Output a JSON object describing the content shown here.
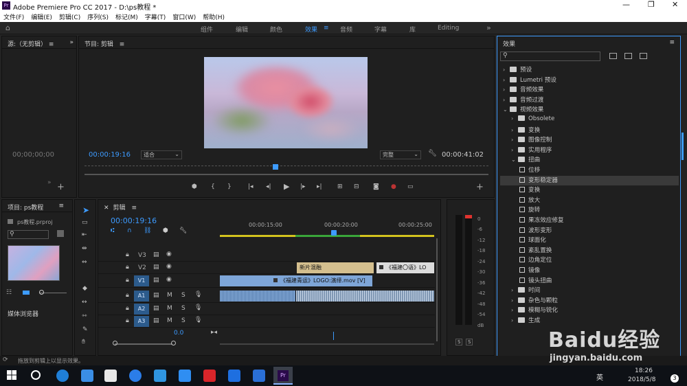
{
  "window": {
    "title": "Adobe Premiere Pro CC 2017 - D:\\ps教程 *"
  },
  "menu": [
    "文件(F)",
    "编辑(E)",
    "剪辑(C)",
    "序列(S)",
    "标记(M)",
    "字幕(T)",
    "窗口(W)",
    "帮助(H)"
  ],
  "workspaces": [
    "组件",
    "编辑",
    "颜色",
    "效果",
    "音频",
    "字幕",
    "库",
    "Editing"
  ],
  "source": {
    "title": "源:（无剪辑）",
    "timecode": "00;00;00;00"
  },
  "program": {
    "title": "节目: 剪辑",
    "timecode": "00:00:19:16",
    "fit": "适合",
    "quality": "完整",
    "duration": "00:00:41:02"
  },
  "project": {
    "title": "项目: ps教程",
    "file": "ps教程.prproj",
    "browser": "媒体浏览器"
  },
  "timeline": {
    "title": "剪辑",
    "timecode": "00:00:19:16",
    "ruler": [
      "00:00:15:00",
      "00:00:20:00",
      "00:00:25:00"
    ],
    "tracks": {
      "v3": "V3",
      "v2": "V2",
      "v1": "V1",
      "a1": "A1",
      "a2": "A2",
      "a3": "A3"
    },
    "master": "0.0",
    "clips": {
      "v2a": "新片混融",
      "v2b": "《福建〇语》LO",
      "v1": "《福建青运》LOGO:演绎.mov [V]"
    }
  },
  "meter": [
    "0",
    "-6",
    "-12",
    "-18",
    "-24",
    "-30",
    "-36",
    "-42",
    "-48",
    "-54",
    "dB"
  ],
  "effects": {
    "title": "效果",
    "items": [
      {
        "label": "预设",
        "level": 0,
        "type": "folder",
        "open": false
      },
      {
        "label": "Lumetri 预设",
        "level": 0,
        "type": "folder",
        "open": false
      },
      {
        "label": "音频效果",
        "level": 0,
        "type": "folder",
        "open": false
      },
      {
        "label": "音频过渡",
        "level": 0,
        "type": "folder",
        "open": false
      },
      {
        "label": "视频效果",
        "level": 0,
        "type": "folder",
        "open": true
      },
      {
        "label": "Obsolete",
        "level": 1,
        "type": "folder",
        "open": false
      },
      {
        "label": "变换",
        "level": 1,
        "type": "folder",
        "open": false
      },
      {
        "label": "图像控制",
        "level": 1,
        "type": "folder",
        "open": false
      },
      {
        "label": "实用程序",
        "level": 1,
        "type": "folder",
        "open": false
      },
      {
        "label": "扭曲",
        "level": 1,
        "type": "folder",
        "open": true
      },
      {
        "label": "位移",
        "level": 2,
        "type": "fx"
      },
      {
        "label": "变形稳定器",
        "level": 2,
        "type": "fx",
        "selected": true
      },
      {
        "label": "变换",
        "level": 2,
        "type": "fx"
      },
      {
        "label": "放大",
        "level": 2,
        "type": "fx"
      },
      {
        "label": "旋转",
        "level": 2,
        "type": "fx"
      },
      {
        "label": "果冻效应修复",
        "level": 2,
        "type": "fx"
      },
      {
        "label": "波形变形",
        "level": 2,
        "type": "fx"
      },
      {
        "label": "球面化",
        "level": 2,
        "type": "fx"
      },
      {
        "label": "紊乱置换",
        "level": 2,
        "type": "fx"
      },
      {
        "label": "边角定位",
        "level": 2,
        "type": "fx"
      },
      {
        "label": "镜像",
        "level": 2,
        "type": "fx"
      },
      {
        "label": "镜头扭曲",
        "level": 2,
        "type": "fx"
      },
      {
        "label": "时间",
        "level": 1,
        "type": "folder",
        "open": false
      },
      {
        "label": "杂色与颗粒",
        "level": 1,
        "type": "folder",
        "open": false
      },
      {
        "label": "模糊与锐化",
        "level": 1,
        "type": "folder",
        "open": false
      },
      {
        "label": "生成",
        "level": 1,
        "type": "folder",
        "open": false
      }
    ]
  },
  "status": {
    "text": "拖放到剪辑上以显示效果。"
  },
  "taskbar": {
    "time": "18:26",
    "date": "2018/5/8",
    "ime": "英",
    "badge": "3"
  },
  "watermark": {
    "line1": "Baidu经验",
    "line2": "jingyan.baidu.com"
  },
  "colors": {
    "accent": "#3d9bff",
    "track": "#2c5b8c",
    "clipVideo": "#7ea6d8",
    "clipAdj": "#d4bf8e"
  }
}
